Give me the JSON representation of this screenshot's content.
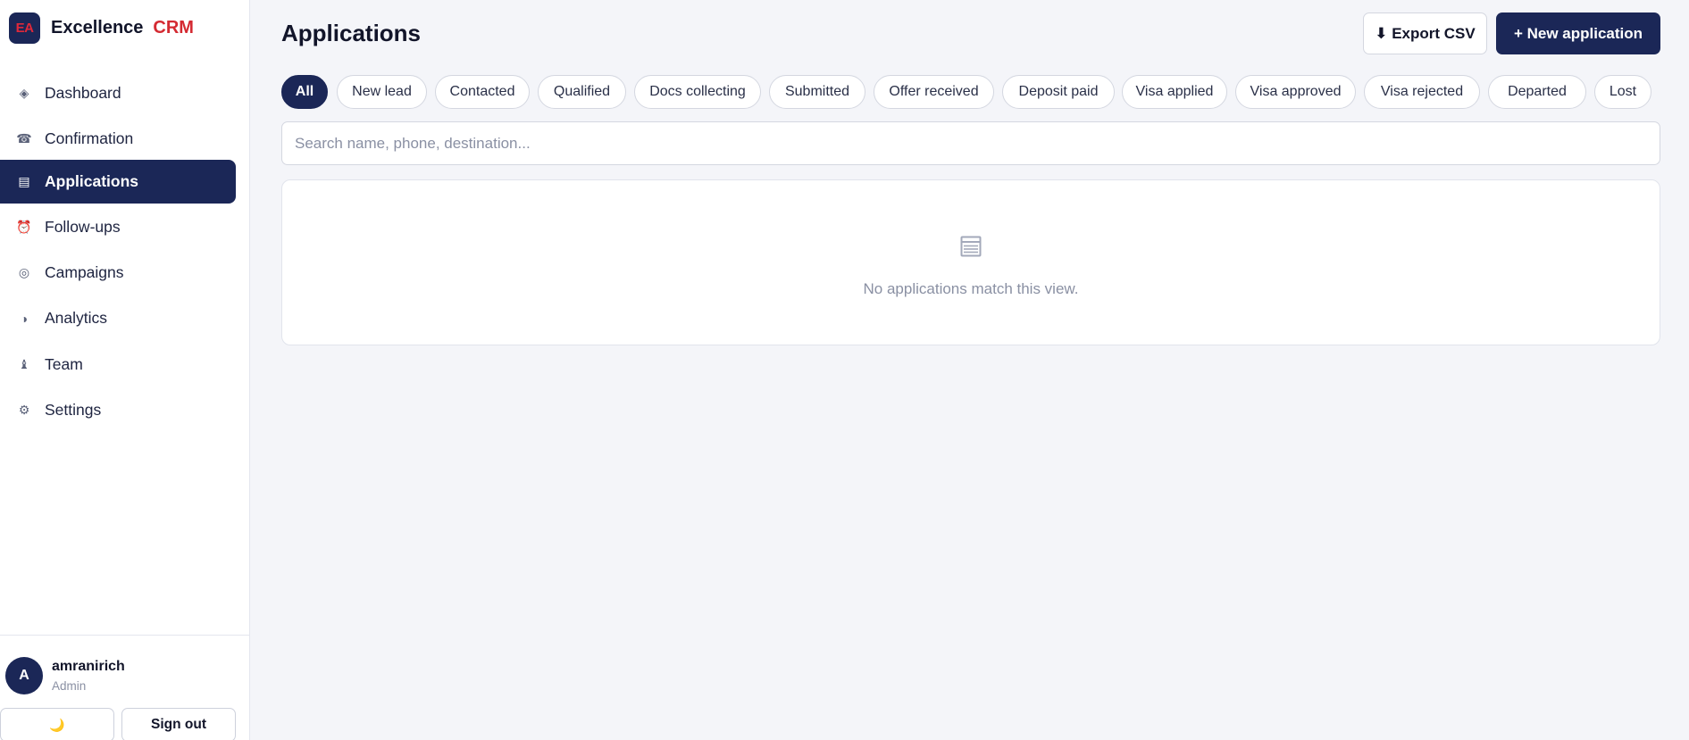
{
  "brand": {
    "logo": "EA",
    "name": "Excellence",
    "accent": "CRM"
  },
  "sidebar": {
    "items": [
      {
        "label": "Dashboard",
        "icon": "diamond-icon",
        "glyph": "◈"
      },
      {
        "label": "Confirmation",
        "icon": "phone-icon",
        "glyph": "☎"
      },
      {
        "label": "Applications",
        "icon": "list-icon",
        "glyph": "▤",
        "active": true
      },
      {
        "label": "Follow-ups",
        "icon": "alarm-clock-icon",
        "glyph": "⏰"
      },
      {
        "label": "Campaigns",
        "icon": "target-icon",
        "glyph": "◎"
      },
      {
        "label": "Analytics",
        "icon": "half-circle-icon",
        "glyph": "◑"
      },
      {
        "label": "Team",
        "icon": "person-icon",
        "glyph": "♝"
      },
      {
        "label": "Settings",
        "icon": "gear-icon",
        "glyph": "⚙"
      }
    ]
  },
  "user": {
    "initial": "A",
    "name": "amranirich",
    "role": "Admin",
    "theme_toggle": "🌙",
    "sign_out": "Sign out"
  },
  "header": {
    "title": "Applications",
    "export_label": "⬇ Export CSV",
    "new_label": "+ New application"
  },
  "filters": [
    "All",
    "New lead",
    "Contacted",
    "Qualified",
    "Docs collecting",
    "Submitted",
    "Offer received",
    "Deposit paid",
    "Visa applied",
    "Visa approved",
    "Visa rejected",
    "Departed",
    "Lost"
  ],
  "active_filter": "All",
  "search": {
    "placeholder": "Search name, phone, destination...",
    "value": ""
  },
  "empty_state": {
    "icon": "list-icon",
    "message": "No applications match this view."
  },
  "colors": {
    "primary": "#1b2757",
    "accent": "#d42a32",
    "background": "#f4f5f9"
  }
}
